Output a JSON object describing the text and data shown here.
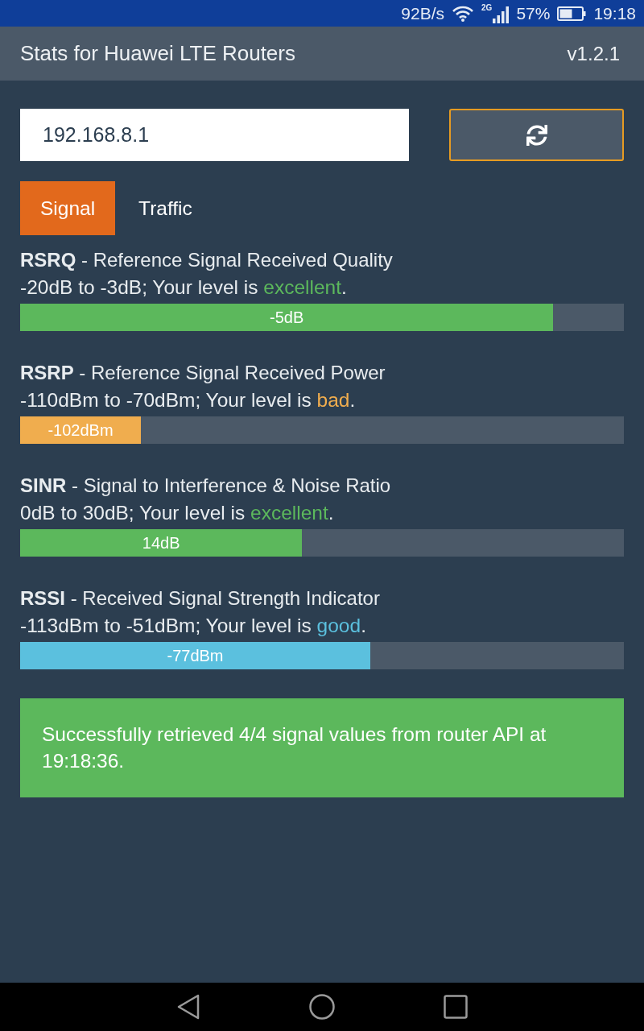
{
  "status_bar": {
    "network_speed": "92B/s",
    "network_type": "2G",
    "battery": "57%",
    "time": "19:18"
  },
  "app_bar": {
    "title": "Stats for Huawei LTE Routers",
    "version": "v1.2.1"
  },
  "router_address": {
    "value": "192.168.8.1"
  },
  "tabs": [
    {
      "label": "Signal",
      "selected": true
    },
    {
      "label": "Traffic",
      "selected": false
    }
  ],
  "metrics": [
    {
      "title": "**RSRQ** - Reference Signal Received Quality",
      "scale": "-20dB to -3dB; Your level is",
      "quality": "excellent",
      "end": ".",
      "level": 0.883,
      "reading": "-5dB",
      "color": "#5cb85c"
    },
    {
      "title": "**RSRP** - Reference Signal Received Power",
      "scale": "-110dBm to -70dBm; Your level is",
      "quality": "bad",
      "end": ".",
      "level": 0.2,
      "reading": "-102dBm",
      "color": "#f0ad4e"
    },
    {
      "title": "**SINR** - Signal to Interference & Noise Ratio",
      "scale": "0dB to 30dB; Your level is",
      "quality": "excellent",
      "end": ".",
      "level": 0.467,
      "reading": "14dB",
      "color": "#5cb85c"
    },
    {
      "title": "**RSSI** - Received Signal Strength Indicator",
      "scale": "-113dBm to -51dBm; Your level is",
      "quality": "good",
      "end": ".",
      "level": 0.58,
      "reading": "-77dBm",
      "color": "#5bc0de"
    }
  ],
  "alert": {
    "kind": "success",
    "message": "Successfully retrieved 4/4 signal values from router API at 19:18:36."
  }
}
